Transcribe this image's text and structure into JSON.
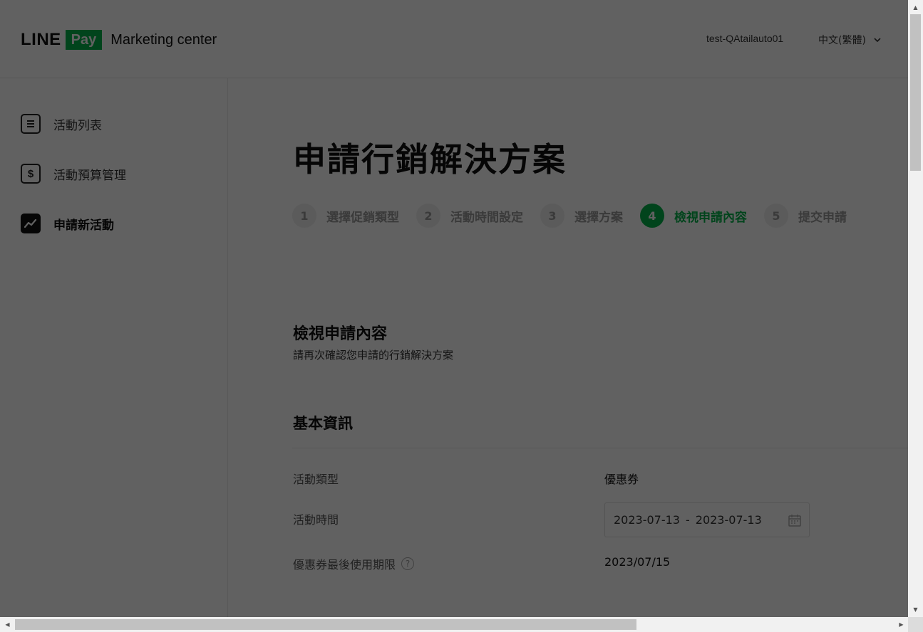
{
  "header": {
    "logo_line": "LINE",
    "logo_pay": "Pay",
    "logo_product": "Marketing center",
    "user": "test-QAtailauto01",
    "language": "中文(繁體)"
  },
  "sidebar": {
    "items": [
      {
        "label": "活動列表",
        "icon": "list-icon",
        "active": false
      },
      {
        "label": "活動預算管理",
        "icon": "dollar-icon",
        "active": false
      },
      {
        "label": "申請新活動",
        "icon": "trend-chart-icon",
        "active": true
      }
    ]
  },
  "main": {
    "title": "申請行銷解決方案",
    "steps": [
      {
        "num": "1",
        "label": "選擇促銷類型"
      },
      {
        "num": "2",
        "label": "活動時間設定"
      },
      {
        "num": "3",
        "label": "選擇方案"
      },
      {
        "num": "4",
        "label": "檢視申請內容",
        "current": true
      },
      {
        "num": "5",
        "label": "提交申請"
      }
    ],
    "section_title": "檢視申請內容",
    "section_subtitle": "請再次確認您申請的行銷解決方案",
    "basic_info_title": "基本資訊",
    "rows": {
      "type_label": "活動類型",
      "type_value": "優惠券",
      "time_label": "活動時間",
      "time_start": "2023-07-13",
      "time_sep": "-",
      "time_end": "2023-07-13",
      "expiry_label": "優惠券最後使用期限",
      "expiry_help": "?",
      "expiry_value": "2023/07/15"
    }
  },
  "colors": {
    "brand_green": "#05b34a",
    "overlay": "rgba(0,0,0,0.62)"
  }
}
